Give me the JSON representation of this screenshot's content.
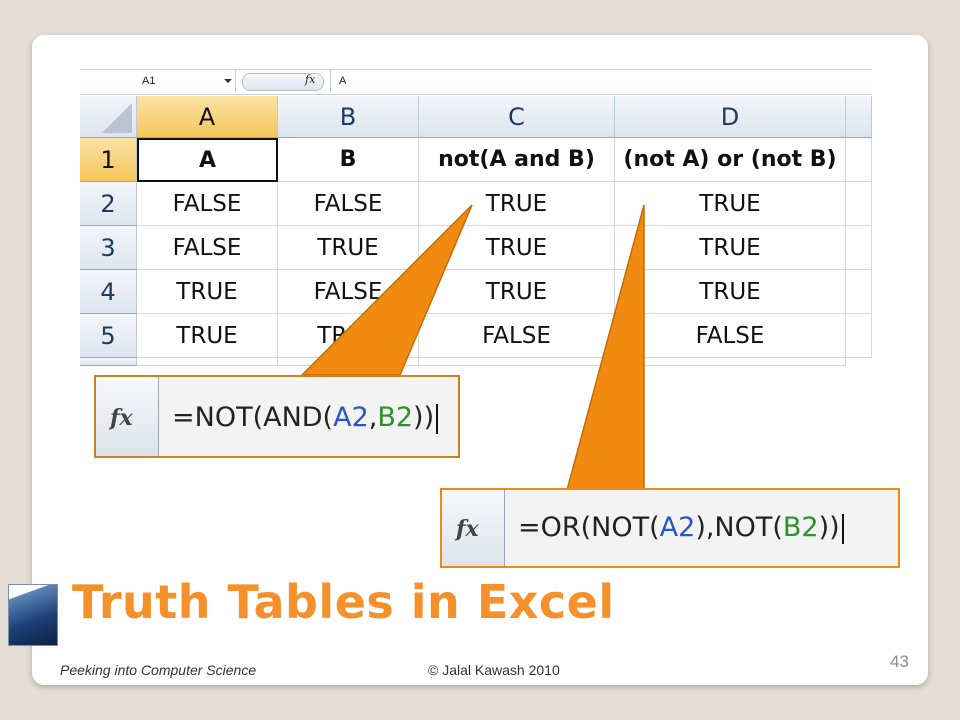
{
  "formula_bar": {
    "cell_ref": "A1",
    "fx_label": "fx",
    "formula": "A"
  },
  "sheet": {
    "column_headers": [
      "A",
      "B",
      "C",
      "D"
    ],
    "selected_column": "A",
    "row_headers": [
      "1",
      "2",
      "3",
      "4",
      "5"
    ],
    "rows": [
      [
        "A",
        "B",
        "not(A and B)",
        "(not A) or (not B)"
      ],
      [
        "FALSE",
        "FALSE",
        "TRUE",
        "TRUE"
      ],
      [
        "FALSE",
        "TRUE",
        "TRUE",
        "TRUE"
      ],
      [
        "TRUE",
        "FALSE",
        "TRUE",
        "TRUE"
      ],
      [
        "TRUE",
        "TRUE",
        "FALSE",
        "FALSE"
      ]
    ]
  },
  "callout1": {
    "fx_label": "fx",
    "parts": [
      "=NOT(AND(",
      "A2",
      ",",
      "B2",
      "))"
    ]
  },
  "callout2": {
    "fx_label": "fx",
    "parts": [
      "=OR(NOT(",
      "A2",
      "),NOT(",
      "B2",
      "))"
    ]
  },
  "colors": {
    "accent": "#f5902a",
    "callout_fill": "#f08a10",
    "callout_border": "#c9841f",
    "ref_a": "#2a55c8",
    "ref_b": "#2e8f2e"
  },
  "slide": {
    "title": "Truth Tables in Excel",
    "footer_left": "Peeking into Computer Science",
    "footer_center": "© Jalal Kawash 2010",
    "page_number": "43"
  }
}
